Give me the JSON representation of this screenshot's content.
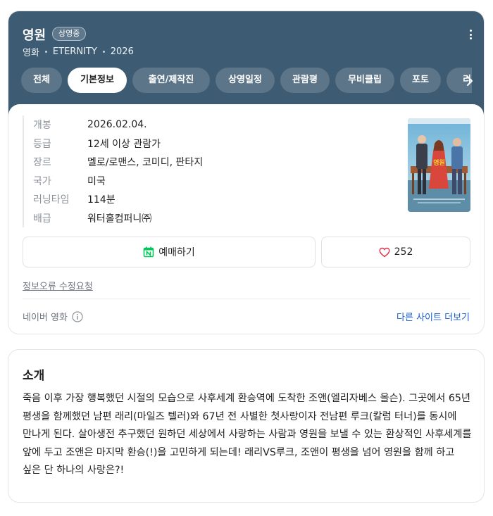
{
  "header": {
    "title": "영원",
    "badge": "상영중",
    "meta": [
      "영화",
      "ETERNITY",
      "2026"
    ],
    "background_color": "#3d5b72"
  },
  "tabs": [
    {
      "label": "전체",
      "active": false
    },
    {
      "label": "기본정보",
      "active": true
    },
    {
      "label": "출연/제작진",
      "active": false
    },
    {
      "label": "상영일정",
      "active": false
    },
    {
      "label": "관람평",
      "active": false
    },
    {
      "label": "무비클립",
      "active": false
    },
    {
      "label": "포토",
      "active": false
    },
    {
      "label": "리뷰",
      "active": false
    }
  ],
  "info": [
    {
      "key": "개봉",
      "value": "2026.02.04."
    },
    {
      "key": "등급",
      "value": "12세 이상 관람가"
    },
    {
      "key": "장르",
      "value": "멜로/로맨스, 코미디, 판타지"
    },
    {
      "key": "국가",
      "value": "미국"
    },
    {
      "key": "러닝타임",
      "value": "114분"
    },
    {
      "key": "배급",
      "value": "워터홀컴퍼니㈜"
    }
  ],
  "actions": {
    "book_label": "예매하기",
    "like_count": "252"
  },
  "report_label": "정보오류 수정요청",
  "source_label": "네이버 영화",
  "other_sites_label": "다른 사이트 더보기",
  "intro": {
    "title": "소개",
    "text": "죽음 이후 가장 행복했던 시절의 모습으로 사후세계 환승역에 도착한 조앤(엘리자베스 올슨). 그곳에서 65년 평생을 함께했던 남편 래리(마일즈 텔러)와 67년 전 사별한 첫사랑이자 전남편 루크(칼럼 터너)를 동시에 만나게 된다. 살아생전 추구했던 원하던 세상에서 사랑하는 사람과 영원을 보낼 수 있는 환상적인 사후세계를 앞에 두고 조앤은 마지막 환승(!)을 고민하게 되는데! 래리VS루크, 조앤이 평생을 넘어 영원을 함께 하고 싶은 단 하나의 사랑은?!"
  },
  "colors": {
    "link": "#1b5fce",
    "heart": "#e0334a",
    "booking_icon": "#03c75a"
  }
}
